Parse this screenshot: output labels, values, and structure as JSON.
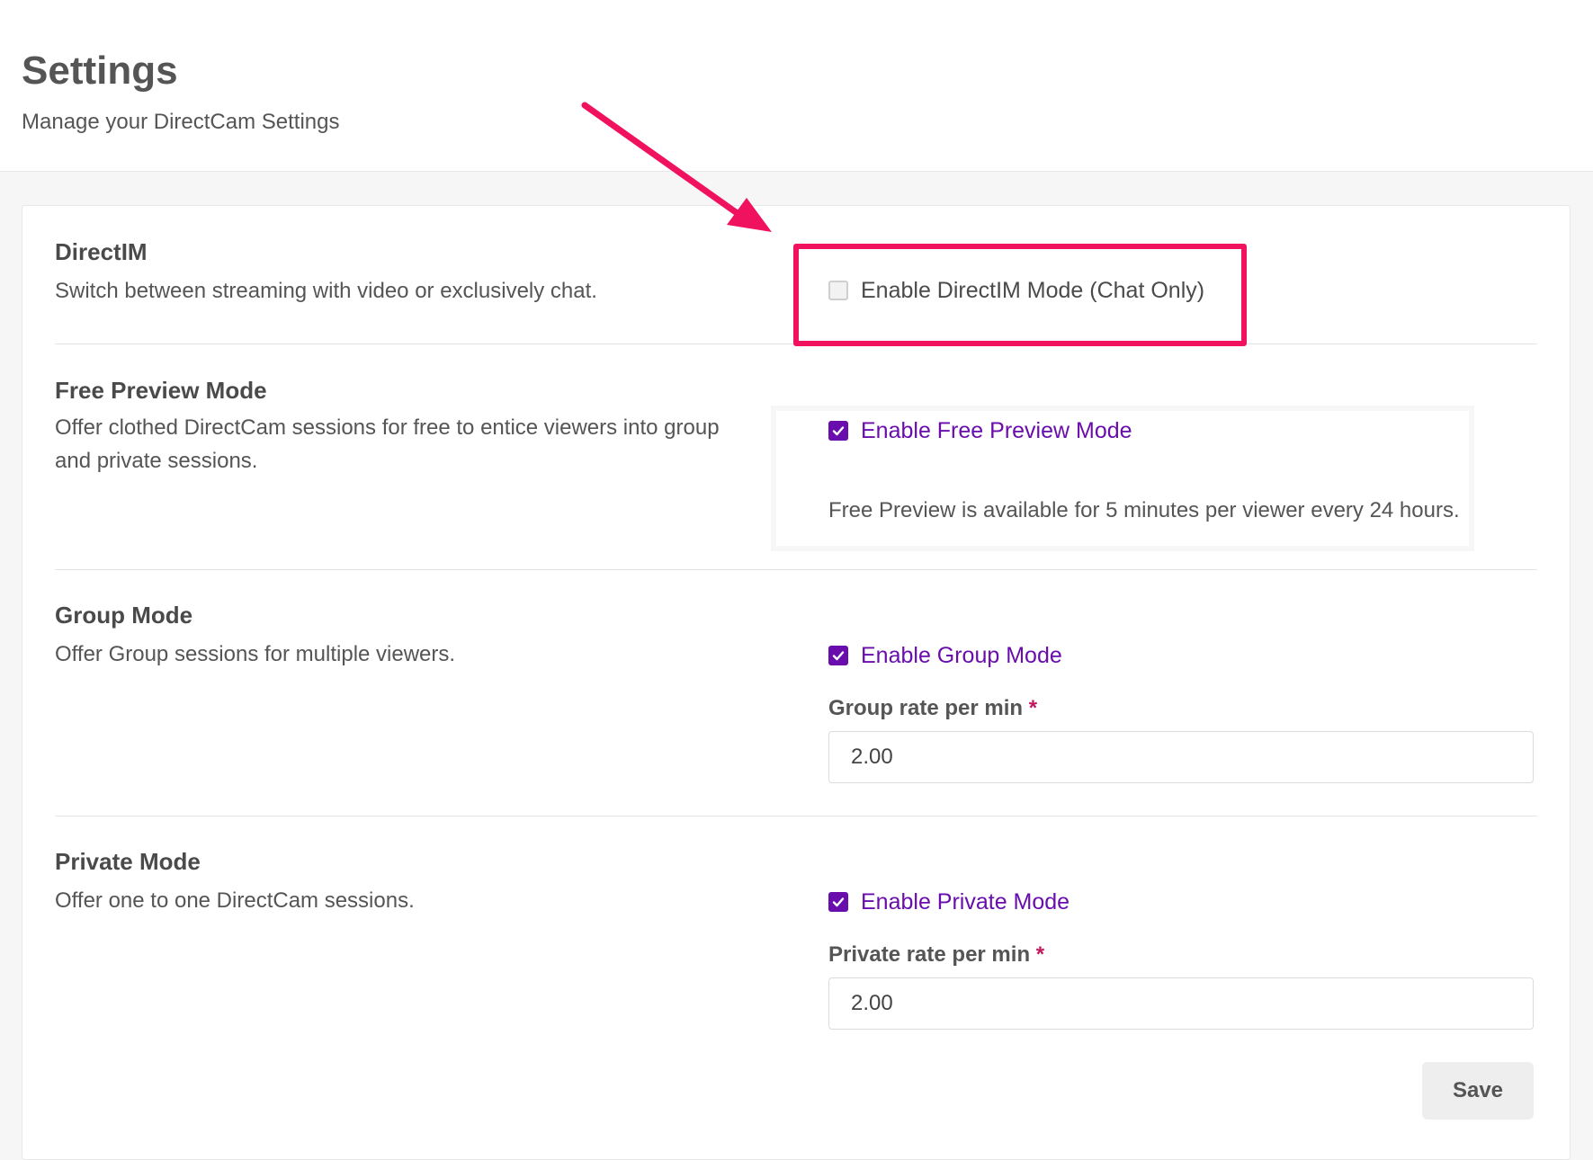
{
  "header": {
    "title": "Settings",
    "subtitle": "Manage your DirectCam Settings"
  },
  "sections": {
    "directim": {
      "title": "DirectIM",
      "description": "Switch between streaming with video or exclusively chat.",
      "checkbox_label": "Enable DirectIM Mode (Chat Only)",
      "checked": false
    },
    "free_preview": {
      "title": "Free Preview Mode",
      "description": "Offer clothed DirectCam sessions for free to entice viewers into group and private sessions.",
      "checkbox_label": "Enable Free Preview Mode",
      "checked": true,
      "note": "Free Preview is available for 5 minutes per viewer every 24 hours."
    },
    "group": {
      "title": "Group Mode",
      "description": "Offer Group sessions for multiple viewers.",
      "checkbox_label": "Enable Group Mode",
      "checked": true,
      "rate_label": "Group rate per min",
      "required_mark": "*",
      "rate_value": "2.00"
    },
    "private": {
      "title": "Private Mode",
      "description": "Offer one to one DirectCam sessions.",
      "checkbox_label": "Enable Private Mode",
      "checked": true,
      "rate_label": "Private rate per min",
      "required_mark": "*",
      "rate_value": "2.00"
    }
  },
  "actions": {
    "save_label": "Save"
  },
  "colors": {
    "accent": "#6a0dad",
    "annotation": "#f0125e",
    "required": "#c2185b"
  },
  "icons": {
    "checked": "check-icon",
    "annotation": "arrow-icon"
  }
}
